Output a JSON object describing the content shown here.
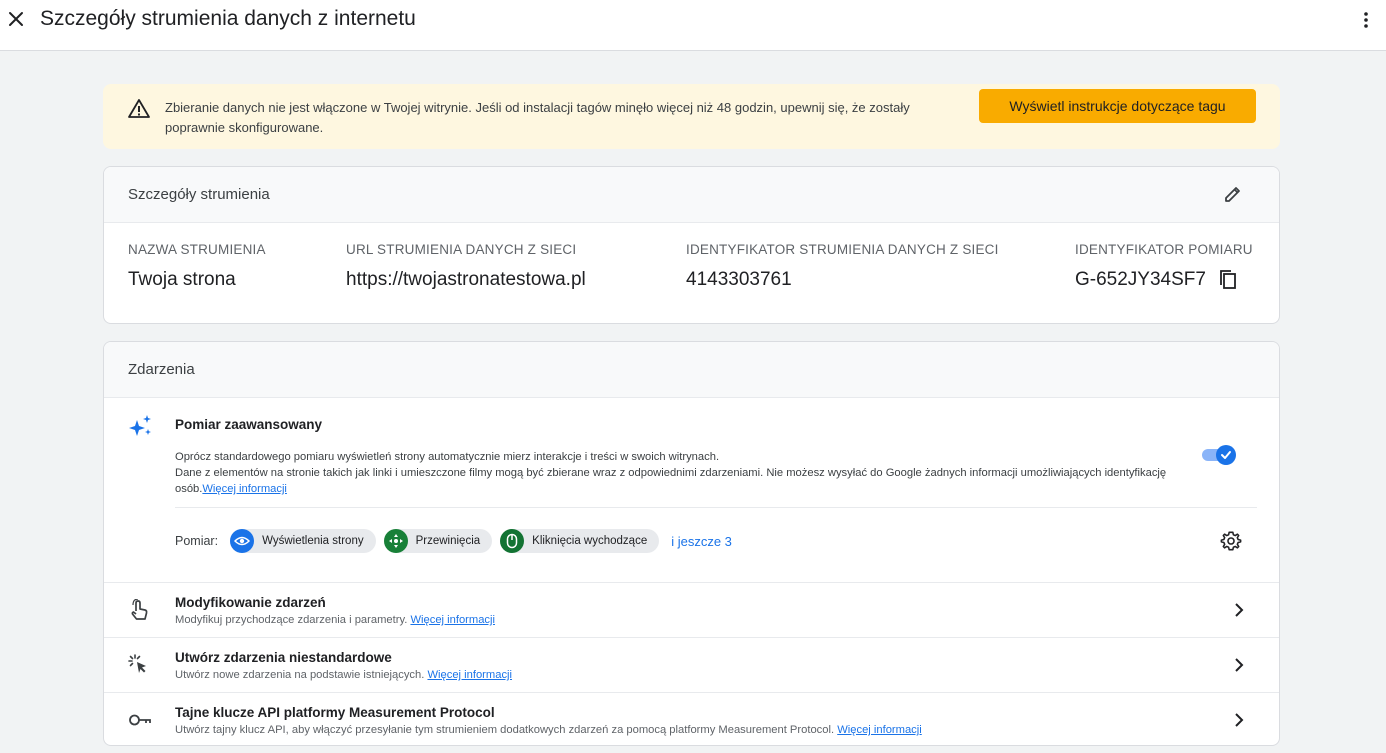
{
  "header": {
    "title": "Szczegóły strumienia danych z internetu"
  },
  "alert": {
    "message": "Zbieranie danych nie jest włączone w Twojej witrynie. Jeśli od instalacji tagów minęło więcej niż 48 godzin, upewnij się, że zostały poprawnie skonfigurowane.",
    "button_label": "Wyświetl instrukcje dotyczące tagu",
    "color": "#f9ab00"
  },
  "stream_details": {
    "title": "Szczegóły strumienia",
    "fields": [
      {
        "label": "NAZWA STRUMIENIA",
        "value": "Twoja strona"
      },
      {
        "label": "URL STRUMIENIA DANYCH Z SIECI",
        "value": "https://twojastronatestowa.pl"
      },
      {
        "label": "IDENTYFIKATOR STRUMIENIA DANYCH Z SIECI",
        "value": "4143303761"
      },
      {
        "label": "IDENTYFIKATOR POMIARU",
        "value": "G-652JY34SF7"
      }
    ]
  },
  "events": {
    "title": "Zdarzenia",
    "enhanced": {
      "title": "Pomiar zaawansowany",
      "desc_line1": "Oprócz standardowego pomiaru wyświetleń strony automatycznie mierz interakcje i treści w swoich witrynach.",
      "desc_line2": "Dane z elementów na stronie takich jak linki i umieszczone filmy mogą być zbierane wraz z odpowiednimi zdarzeniami. Nie możesz wysyłać do Google żadnych informacji umożliwiających identyfikację osób.",
      "link": "Więcej informacji",
      "enabled": true,
      "measure_label": "Pomiar:",
      "chips": [
        {
          "label": "Wyświetlenia strony",
          "icon": "eye-icon",
          "color": "#1a73e8"
        },
        {
          "label": "Przewinięcia",
          "icon": "scroll-crosshair-icon",
          "color": "#188038"
        },
        {
          "label": "Kliknięcia wychodzące",
          "icon": "mouse-icon",
          "color": "#137333"
        }
      ],
      "more": "i jeszcze 3"
    },
    "rows": [
      {
        "title": "Modyfikowanie zdarzeń",
        "desc": "Modyfikuj przychodzące zdarzenia i parametry.",
        "link": "Więcej informacji",
        "icon": "touch-icon"
      },
      {
        "title": "Utwórz zdarzenia niestandardowe",
        "desc": "Utwórz nowe zdarzenia na podstawie istniejących.",
        "link": "Więcej informacji",
        "icon": "cursor-click-icon"
      },
      {
        "title": "Tajne klucze API platformy Measurement Protocol",
        "desc": "Utwórz tajny klucz API, aby włączyć przesyłanie tym strumieniem dodatkowych zdarzeń za pomocą platformy Measurement Protocol.",
        "link": "Więcej informacji",
        "icon": "key-icon"
      }
    ]
  }
}
